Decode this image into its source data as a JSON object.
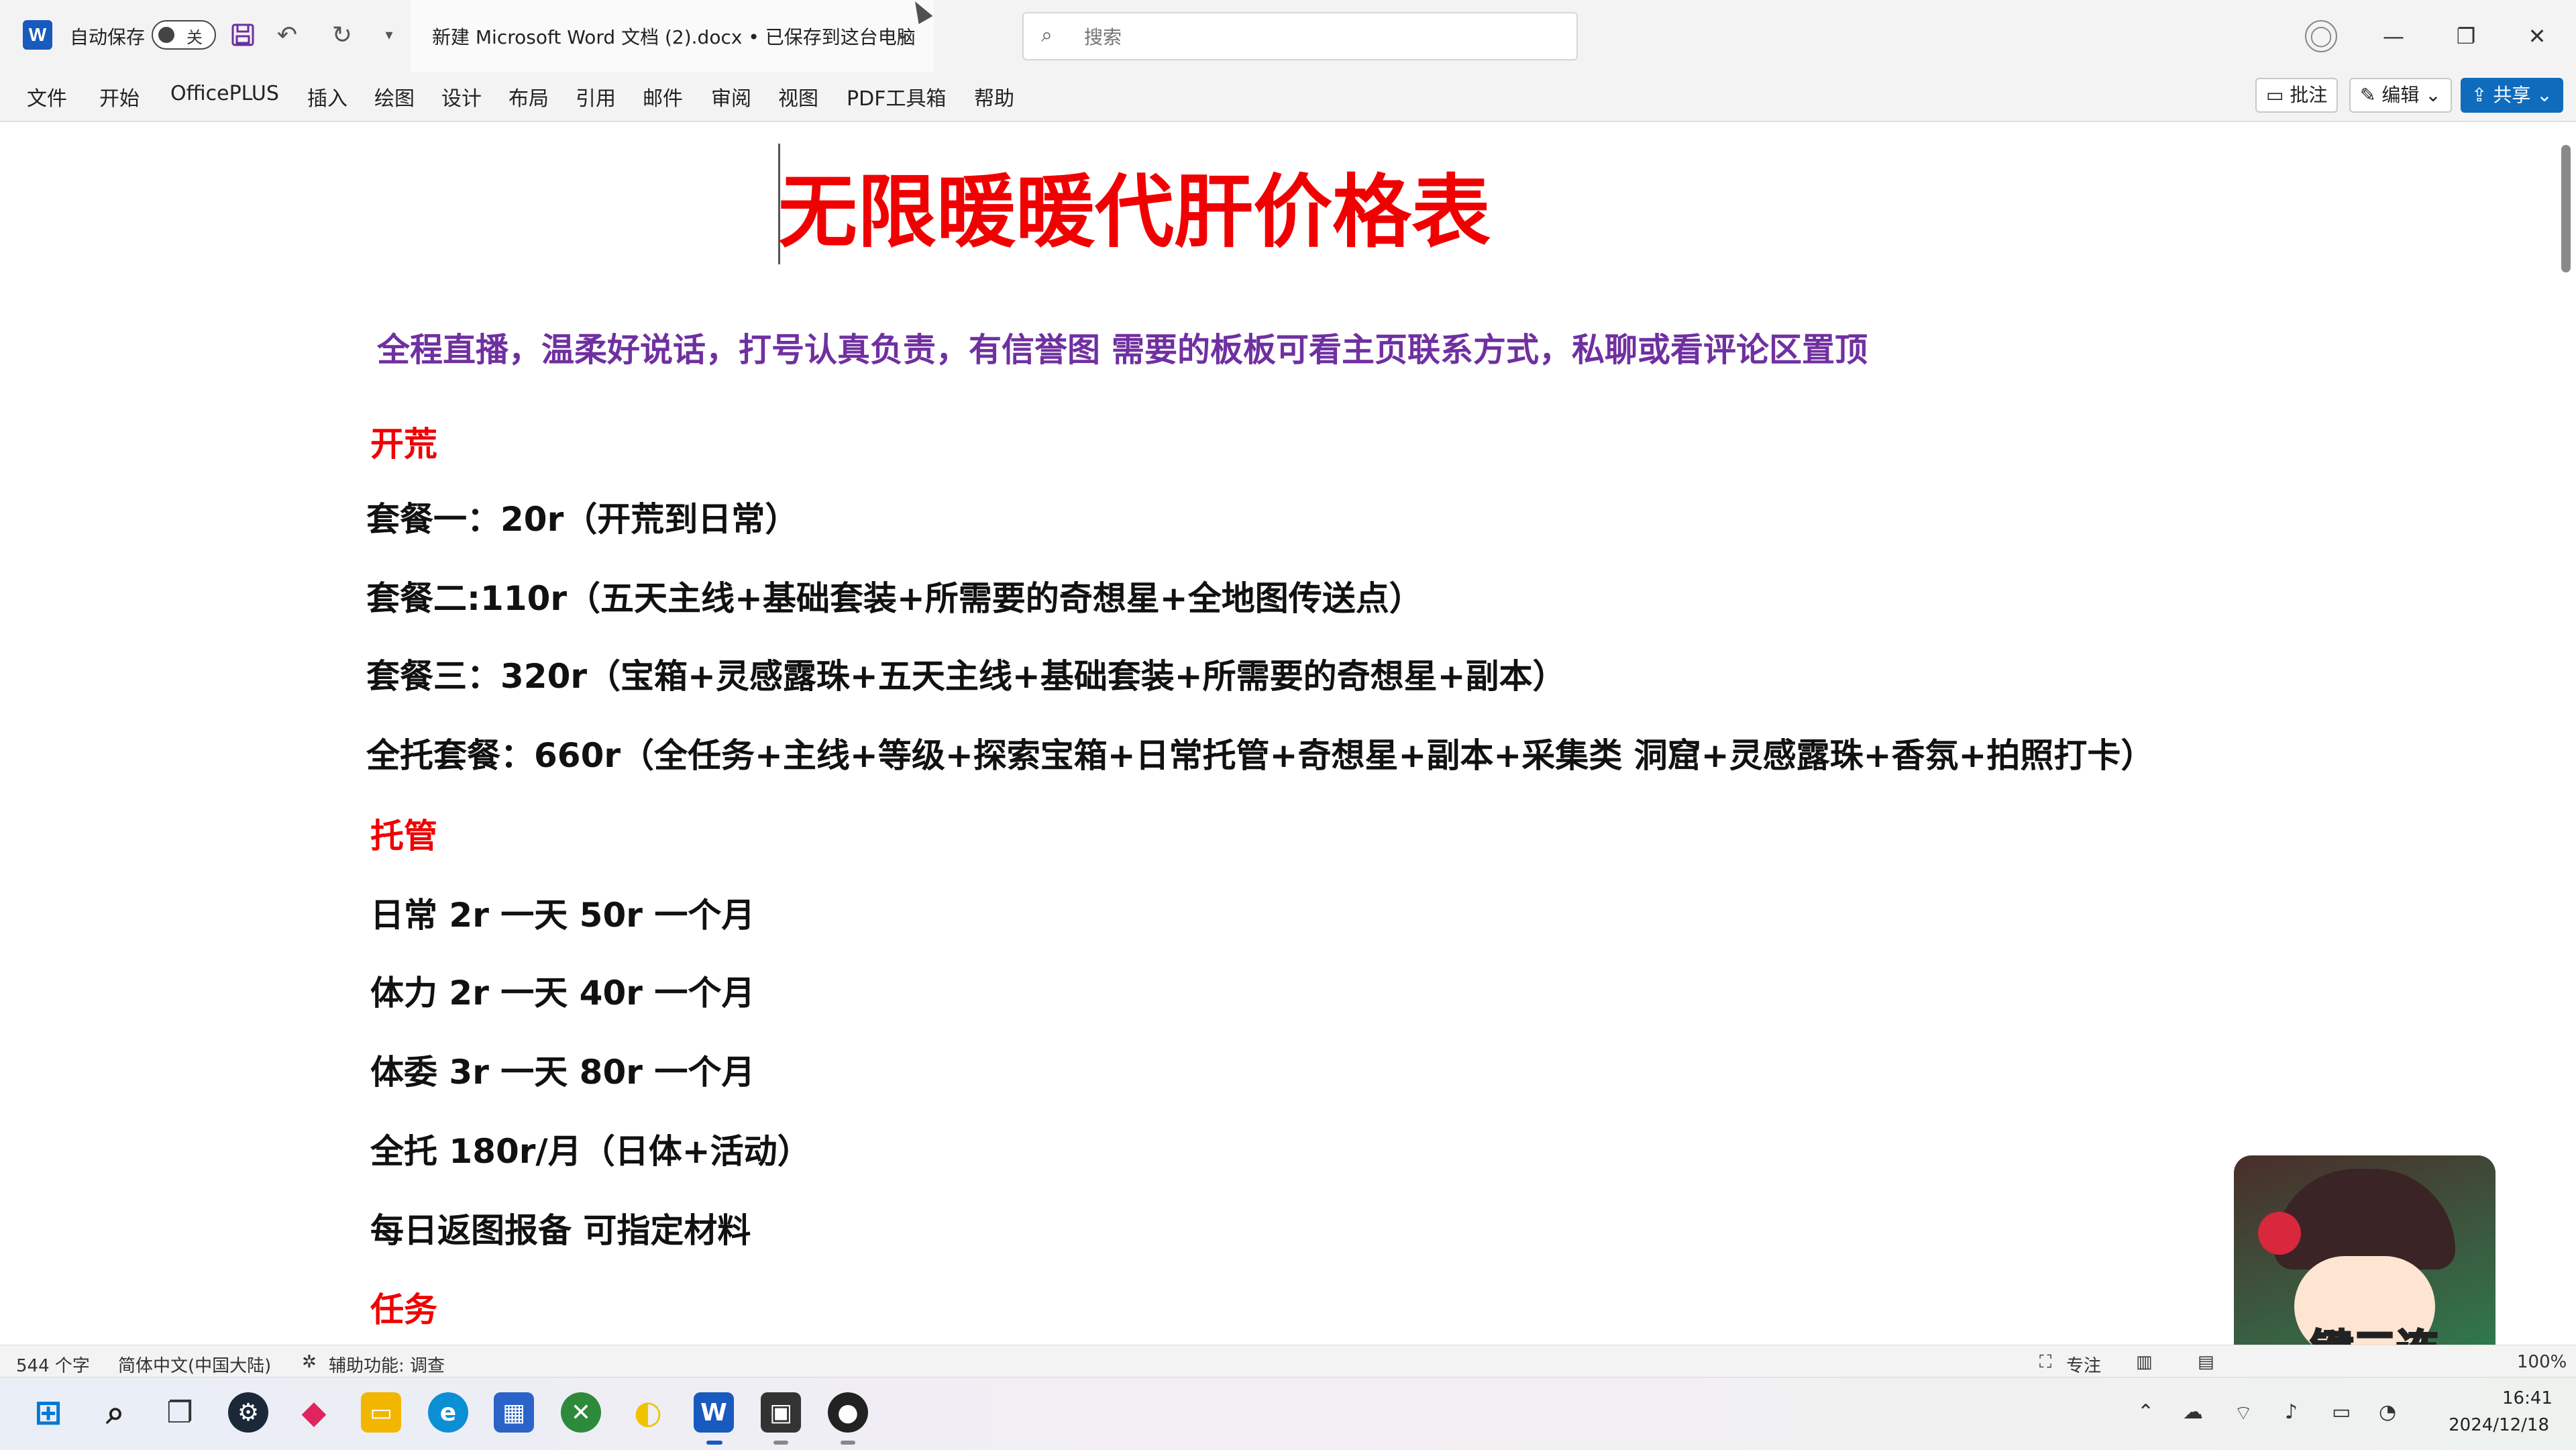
{
  "titlebar": {
    "app_logo": "W",
    "autosave_label": "自动保存",
    "autosave_state": "关",
    "doc_title": "新建 Microsoft Word 文档 (2).docx • 已保存到这台电脑",
    "search_placeholder": "搜索"
  },
  "menu": [
    "文件",
    "开始",
    "OfficePLUS",
    "插入",
    "绘图",
    "设计",
    "布局",
    "引用",
    "邮件",
    "审阅",
    "视图",
    "PDF工具箱",
    "帮助"
  ],
  "ribbon_buttons": {
    "comment": "批注",
    "edit": "编辑",
    "share": "共享"
  },
  "document": {
    "title": "无限暖暖代肝价格表",
    "subtitle": "全程直播，温柔好说话，打号认真负责，有信誉图    需要的板板可看主页联系方式，私聊或看评论区置顶",
    "sections": [
      {
        "heading": "开荒",
        "lines": [
          "套餐一：20r（开荒到日常）",
          "套餐二:110r（五天主线+基础套装+所需要的奇想星+全地图传送点）",
          "套餐三：320r（宝箱+灵感露珠+五天主线+基础套装+所需要的奇想星+副本）",
          "全托套餐：660r（全任务+主线+等级+探索宝箱+日常托管+奇想星+副本+采集类 洞窟+灵感露珠+香氛+拍照打卡）"
        ]
      },
      {
        "heading": "托管",
        "lines": [
          "日常 2r 一天   50r 一个月",
          "体力 2r 一天   40r 一个月",
          "体委 3r 一天   80r 一个月",
          "全托 180r/月（日体+活动）",
          "每日返图报备  可指定材料"
        ]
      },
      {
        "heading": "任务",
        "lines": []
      }
    ]
  },
  "sticker": {
    "text": "一键三连"
  },
  "statusbar": {
    "word_count": "544 个字",
    "language": "简体中文(中国大陆)",
    "accessibility": "辅助功能: 调查",
    "focus": "专注",
    "zoom": "100%"
  },
  "taskbar": {
    "time": "16:41",
    "date": "2024/12/18"
  },
  "colors": {
    "title_red": "#f00000",
    "subtitle_purple": "#7030a0",
    "share_blue": "#0f6cbd",
    "word_blue": "#185abd"
  }
}
